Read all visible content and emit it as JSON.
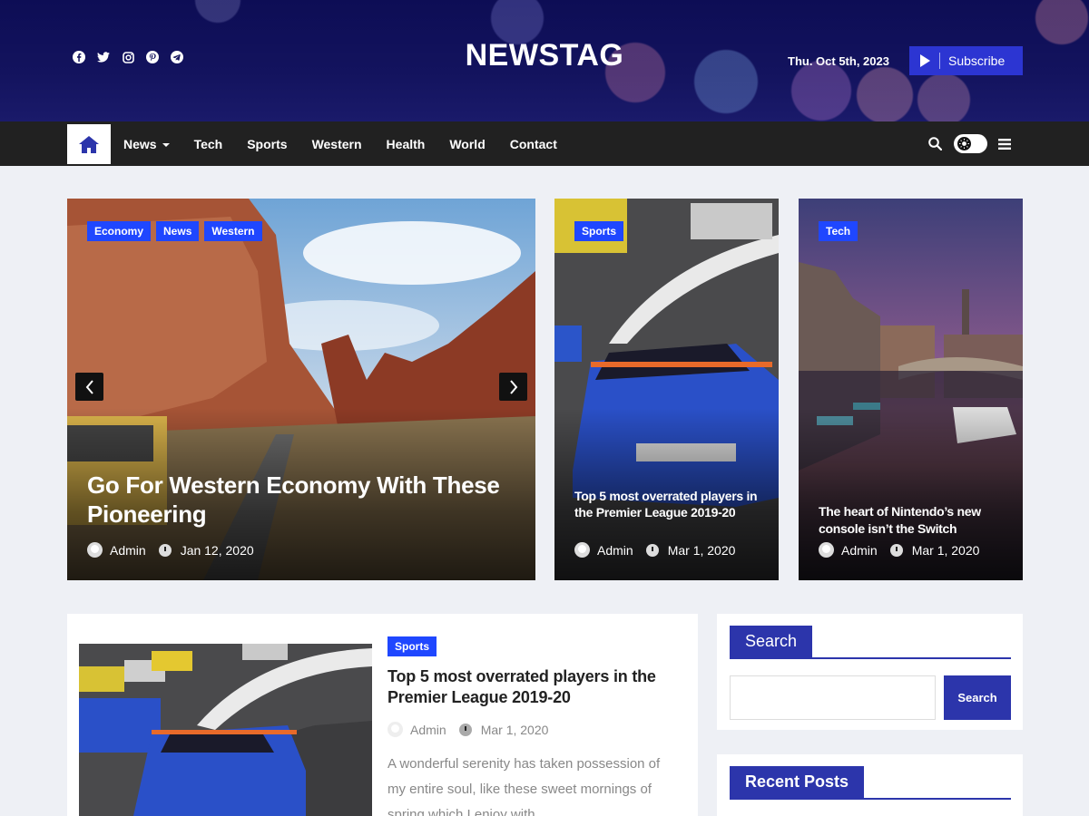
{
  "header": {
    "logo": "NEWSTAG",
    "date": "Thu. Oct 5th, 2023",
    "subscribe_label": "Subscribe",
    "social_icons": [
      "facebook-icon",
      "twitter-icon",
      "instagram-icon",
      "pinterest-icon",
      "telegram-icon"
    ]
  },
  "nav": {
    "items": [
      "News",
      "Tech",
      "Sports",
      "Western",
      "Health",
      "World",
      "Contact"
    ]
  },
  "featured": {
    "main": {
      "tags": [
        "Economy",
        "News",
        "Western"
      ],
      "title": "Go For Western Economy With These Pioneering",
      "author": "Admin",
      "date": "Jan 12, 2020"
    },
    "second": {
      "tags": [
        "Sports"
      ],
      "title": "Top 5 most overrated players in the Premier League 2019-20",
      "author": "Admin",
      "date": "Mar 1, 2020"
    },
    "third": {
      "tags": [
        "Tech"
      ],
      "title": "The heart of Nintendo’s new console isn’t the Switch",
      "author": "Admin",
      "date": "Mar 1, 2020"
    }
  },
  "post": {
    "tag": "Sports",
    "title": "Top 5 most overrated players in the Premier League 2019-20",
    "author": "Admin",
    "date": "Mar 1, 2020",
    "excerpt": "A wonderful serenity has taken possession of my entire soul, like these sweet mornings of spring which I enjoy with…"
  },
  "sidebar": {
    "search_title": "Search",
    "search_button": "Search",
    "search_placeholder": "",
    "recent_title": "Recent Posts"
  },
  "colors": {
    "accent": "#2c35ab",
    "tag_blue": "#1f47ff",
    "nav_bg": "#212121",
    "header_bg": "#13135e"
  }
}
